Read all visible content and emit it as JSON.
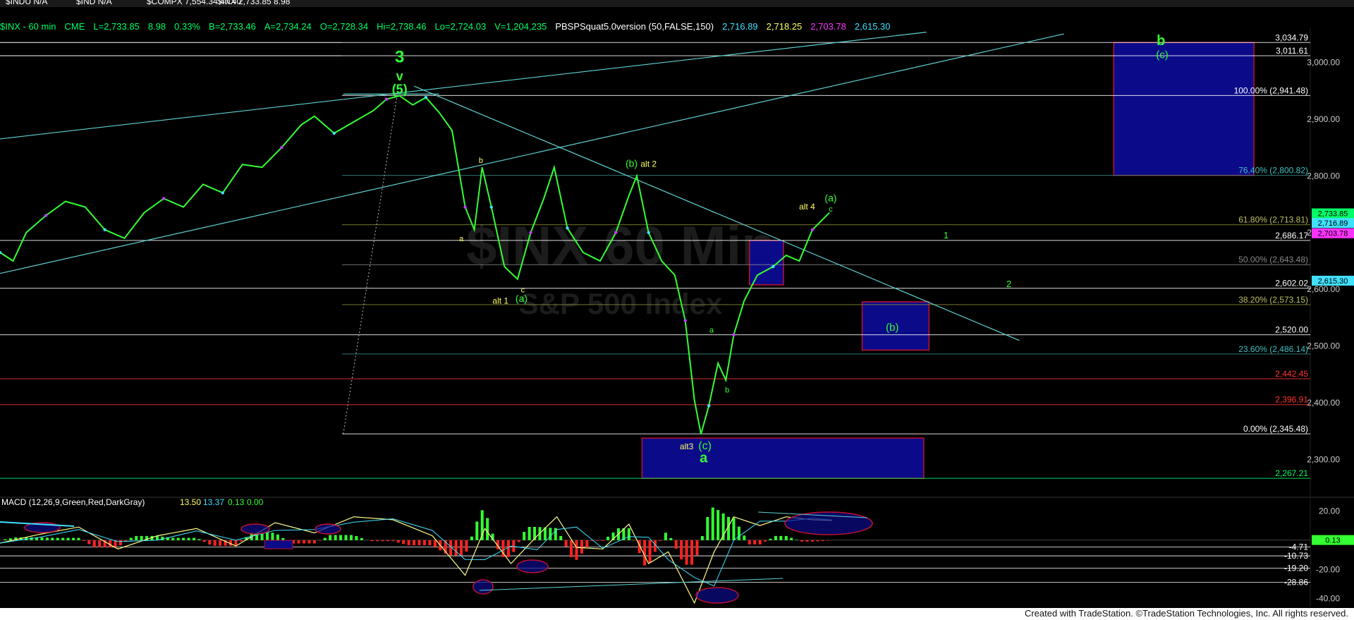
{
  "topbar": [
    {
      "label": "$INDU N/A",
      "color": "#ffffff"
    },
    {
      "label": "$IND N/A",
      "color": "#ffffff"
    },
    {
      "label": "$COMPX 7,554.34 47.40",
      "color": "#ffffff"
    },
    {
      "label": "$INX 2,733.85 8.98",
      "color": "#ffffff"
    }
  ],
  "header": {
    "symbol": "$INX - 60 min",
    "exchange": "CME",
    "last": "L=2,733.85",
    "chg": "8.98",
    "pct": "0.33%",
    "bid": "B=2,733.46",
    "ask": "A=2,734.24",
    "open": "O=2,728.34",
    "high": "Hi=2,738.46",
    "low": "Lo=2,724.03",
    "vol": "V=1,204,235",
    "study": "PBSPSquat5.0version (50,FALSE,150)",
    "v1": "2,716.89",
    "v2": "2,718.25",
    "v3": "2,703.78",
    "v4": "2,615.30",
    "colors": {
      "v1": "#40e0ff",
      "v2": "#ffff66",
      "v3": "#ff33ff",
      "v4": "#40e0ff"
    }
  },
  "watermark": {
    "line1": "$INX 60 Min",
    "line2": "S&P 500 Index"
  },
  "price_axis": {
    "ticks": [
      "3,000.00",
      "2,900.00",
      "2,800.00",
      "2,700.00",
      "2,600.00",
      "2,500.00",
      "2,400.00",
      "2,300.00"
    ]
  },
  "price_scale": {
    "min": 2240,
    "max": 3060
  },
  "levels": [
    {
      "value": 3034.79,
      "label": "3,034.79",
      "color": "#ffffff"
    },
    {
      "value": 3011.61,
      "label": "3,011.61",
      "color": "#ffffff"
    },
    {
      "value": 2941.48,
      "label": "100.00% (2,941.48)",
      "color": "#ffffff"
    },
    {
      "value": 2800.82,
      "label": "76.40% (2,800.82)",
      "color": "#3a8a8a"
    },
    {
      "value": 2713.81,
      "label": "61.80% (2,713.81)",
      "color": "#8a8a3a"
    },
    {
      "value": 2686.17,
      "label": "2,686.17",
      "color": "#ffffff"
    },
    {
      "value": 2643.48,
      "label": "50.00% (2,643.48)",
      "color": "#888888"
    },
    {
      "value": 2602.02,
      "label": "2,602.02",
      "color": "#ffffff"
    },
    {
      "value": 2573.15,
      "label": "38.20% (2,573.15)",
      "color": "#8a8a3a"
    },
    {
      "value": 2520.0,
      "label": "2,520.00",
      "color": "#ffffff"
    },
    {
      "value": 2486.14,
      "label": "23.60% (2,486.14)",
      "color": "#3a8a8a"
    },
    {
      "value": 2442.45,
      "label": "2,442.45",
      "color": "#ff3333"
    },
    {
      "value": 2396.91,
      "label": "2,396.91",
      "color": "#ff3333"
    },
    {
      "value": 2345.48,
      "label": "0.00% (2,345.48)",
      "color": "#ffffff"
    },
    {
      "value": 2267.21,
      "label": "2,267.21",
      "color": "#00ff66"
    }
  ],
  "price_tags": [
    {
      "value": 2733.85,
      "label": "2,733.85",
      "bg": "#00ff66"
    },
    {
      "value": 2716.89,
      "label": "2,716.89",
      "bg": "#40e0ff"
    },
    {
      "value": 2703.78,
      "label": "2,703.78",
      "bg": "#ff33ff"
    },
    {
      "value": 2615.3,
      "label": "2,615.30",
      "bg": "#40e0ff"
    }
  ],
  "annotations": [
    {
      "text": "3",
      "color": "#33ff33",
      "size": 24,
      "bold": true,
      "price": 3000,
      "bar": 0.305
    },
    {
      "text": "v",
      "color": "#33ff33",
      "size": 18,
      "bold": true,
      "price": 2968,
      "bar": 0.305
    },
    {
      "text": "(5)",
      "color": "#33ff33",
      "size": 18,
      "bold": true,
      "price": 2945,
      "bar": 0.305
    },
    {
      "text": "b",
      "color": "#ffff66",
      "size": 11,
      "price": 2823,
      "bar": 0.367
    },
    {
      "text": "a",
      "color": "#ffff66",
      "size": 11,
      "price": 2685,
      "bar": 0.352
    },
    {
      "text": "c",
      "color": "#ffff66",
      "size": 11,
      "price": 2595,
      "bar": 0.399
    },
    {
      "text": "alt 1",
      "color": "#ffff66",
      "size": 12,
      "price": 2575,
      "bar": 0.382
    },
    {
      "text": "(a)",
      "color": "#33ff33",
      "size": 14,
      "price": 2578,
      "bar": 0.398
    },
    {
      "text": "(b)",
      "color": "#33ff33",
      "size": 14,
      "price": 2816,
      "bar": 0.482
    },
    {
      "text": "alt 2",
      "color": "#ffff66",
      "size": 12,
      "price": 2816,
      "bar": 0.495
    },
    {
      "text": "alt 4",
      "color": "#ffff66",
      "size": 12,
      "price": 2741,
      "bar": 0.616
    },
    {
      "text": "(a)",
      "color": "#33ff33",
      "size": 14,
      "price": 2755,
      "bar": 0.634
    },
    {
      "text": "c",
      "color": "#33ff33",
      "size": 11,
      "price": 2737,
      "bar": 0.634
    },
    {
      "text": "1",
      "color": "#33ff33",
      "size": 13,
      "price": 2690,
      "bar": 0.722
    },
    {
      "text": "2",
      "color": "#33ff33",
      "size": 13,
      "price": 2604,
      "bar": 0.77
    },
    {
      "text": "a",
      "color": "#33ff33",
      "size": 11,
      "price": 2524,
      "bar": 0.543
    },
    {
      "text": "b",
      "color": "#33ff33",
      "size": 11,
      "price": 2418,
      "bar": 0.555
    },
    {
      "text": "alt3",
      "color": "#ffff66",
      "size": 12,
      "price": 2318,
      "bar": 0.524
    },
    {
      "text": "(c)",
      "color": "#33ff33",
      "size": 16,
      "price": 2318,
      "bar": 0.538
    },
    {
      "text": "a",
      "color": "#33ff33",
      "size": 20,
      "bold": true,
      "price": 2295,
      "bar": 0.537
    },
    {
      "text": "(b)",
      "color": "#33ff33",
      "size": 15,
      "price": 2527,
      "bar": 0.681
    },
    {
      "text": "b",
      "color": "#33ff33",
      "size": 20,
      "bold": true,
      "price": 3030,
      "bar": 0.886
    },
    {
      "text": "(c)",
      "color": "#33ff33",
      "size": 15,
      "price": 3007,
      "bar": 0.887
    }
  ],
  "boxes": [
    {
      "name": "target-box-b",
      "p1": 3034.79,
      "p2": 2800.82,
      "x1": 0.85,
      "x2": 0.957
    },
    {
      "name": "box-wave-4",
      "p1": 2686.17,
      "p2": 2608,
      "x1": 0.572,
      "x2": 0.598
    },
    {
      "name": "box-wave-b",
      "p1": 2578,
      "p2": 2493,
      "x1": 0.658,
      "x2": 0.709
    },
    {
      "name": "box-wave-a",
      "p1": 2338,
      "p2": 2267.21,
      "x1": 0.49,
      "x2": 0.705
    }
  ],
  "trendlines": [
    {
      "name": "channel-lower",
      "x1": 0,
      "p1": 2628,
      "x2": 0.812,
      "p2": 3050
    },
    {
      "name": "channel-upper",
      "x1": 0,
      "p1": 2865,
      "x2": 0.707,
      "p2": 3053
    },
    {
      "name": "top-line",
      "x1": 0.262,
      "p1": 2944,
      "x2": 0.335,
      "p2": 2944
    },
    {
      "name": "downtrend",
      "x1": 0.316,
      "p1": 2958,
      "x2": 0.778,
      "p2": 2510
    }
  ],
  "macd": {
    "label": "MACD (12,26,9,Green,Red,DarkGray)",
    "v1": "13.50",
    "v2": "13.37",
    "v3": "0.13",
    "v4": "0.00",
    "ticks": [
      {
        "value": 20,
        "label": "20.00"
      },
      {
        "value": 0,
        "label": "0.00"
      },
      {
        "value": -20,
        "label": "-20.00"
      },
      {
        "value": -40,
        "label": "-40.00"
      }
    ],
    "levels": [
      {
        "value": -4.71,
        "label": "-4.71"
      },
      {
        "value": -10.73,
        "label": "-10.73"
      },
      {
        "value": -19.2,
        "label": "-19.20"
      },
      {
        "value": -28.86,
        "label": "-28.86"
      }
    ],
    "tag": {
      "value": 0.13,
      "label": "0.13"
    },
    "scale": {
      "min": -44,
      "max": 26
    }
  },
  "chart_data": {
    "type": "line",
    "title": "$INX - 60 min",
    "series": [
      {
        "name": "$INX",
        "points": [
          [
            0,
            2665
          ],
          [
            0.01,
            2650
          ],
          [
            0.02,
            2700
          ],
          [
            0.035,
            2730
          ],
          [
            0.05,
            2755
          ],
          [
            0.065,
            2745
          ],
          [
            0.08,
            2705
          ],
          [
            0.095,
            2690
          ],
          [
            0.11,
            2735
          ],
          [
            0.125,
            2760
          ],
          [
            0.14,
            2745
          ],
          [
            0.155,
            2785
          ],
          [
            0.17,
            2770
          ],
          [
            0.185,
            2820
          ],
          [
            0.2,
            2815
          ],
          [
            0.215,
            2850
          ],
          [
            0.23,
            2890
          ],
          [
            0.24,
            2905
          ],
          [
            0.255,
            2875
          ],
          [
            0.27,
            2895
          ],
          [
            0.285,
            2915
          ],
          [
            0.295,
            2935
          ],
          [
            0.305,
            2941
          ],
          [
            0.315,
            2925
          ],
          [
            0.325,
            2938
          ],
          [
            0.335,
            2912
          ],
          [
            0.345,
            2880
          ],
          [
            0.355,
            2745
          ],
          [
            0.362,
            2705
          ],
          [
            0.368,
            2815
          ],
          [
            0.375,
            2745
          ],
          [
            0.385,
            2640
          ],
          [
            0.395,
            2618
          ],
          [
            0.405,
            2700
          ],
          [
            0.415,
            2760
          ],
          [
            0.423,
            2815
          ],
          [
            0.433,
            2708
          ],
          [
            0.445,
            2665
          ],
          [
            0.458,
            2650
          ],
          [
            0.47,
            2700
          ],
          [
            0.48,
            2765
          ],
          [
            0.486,
            2800
          ],
          [
            0.495,
            2700
          ],
          [
            0.505,
            2650
          ],
          [
            0.515,
            2625
          ],
          [
            0.523,
            2545
          ],
          [
            0.53,
            2405
          ],
          [
            0.535,
            2345
          ],
          [
            0.541,
            2395
          ],
          [
            0.548,
            2470
          ],
          [
            0.554,
            2440
          ],
          [
            0.56,
            2520
          ],
          [
            0.568,
            2580
          ],
          [
            0.578,
            2625
          ],
          [
            0.59,
            2640
          ],
          [
            0.6,
            2660
          ],
          [
            0.61,
            2650
          ],
          [
            0.62,
            2705
          ],
          [
            0.633,
            2735
          ]
        ]
      }
    ],
    "ylim": [
      2240,
      3060
    ],
    "y_ticks": [
      "3,000.00",
      "2,900.00",
      "2,800.00",
      "2,700.00",
      "2,600.00",
      "2,500.00",
      "2,400.00",
      "2,300.00"
    ],
    "grid": false,
    "macd_series": [
      [
        0,
        -2
      ],
      [
        0.03,
        4
      ],
      [
        0.06,
        9
      ],
      [
        0.09,
        -6
      ],
      [
        0.12,
        3
      ],
      [
        0.15,
        8
      ],
      [
        0.18,
        -4
      ],
      [
        0.21,
        12
      ],
      [
        0.24,
        5
      ],
      [
        0.27,
        16
      ],
      [
        0.3,
        14
      ],
      [
        0.33,
        3
      ],
      [
        0.355,
        -24
      ],
      [
        0.37,
        8
      ],
      [
        0.39,
        -16
      ],
      [
        0.41,
        3
      ],
      [
        0.425,
        16
      ],
      [
        0.44,
        -5
      ],
      [
        0.46,
        -6
      ],
      [
        0.48,
        11
      ],
      [
        0.495,
        -16
      ],
      [
        0.51,
        -8
      ],
      [
        0.53,
        -43
      ],
      [
        0.545,
        -8
      ],
      [
        0.56,
        16
      ],
      [
        0.58,
        10
      ],
      [
        0.6,
        16
      ],
      [
        0.62,
        14
      ],
      [
        0.635,
        13.5
      ]
    ]
  },
  "footer": "Created with TradeStation. ©TradeStation Technologies, Inc. All rights reserved."
}
